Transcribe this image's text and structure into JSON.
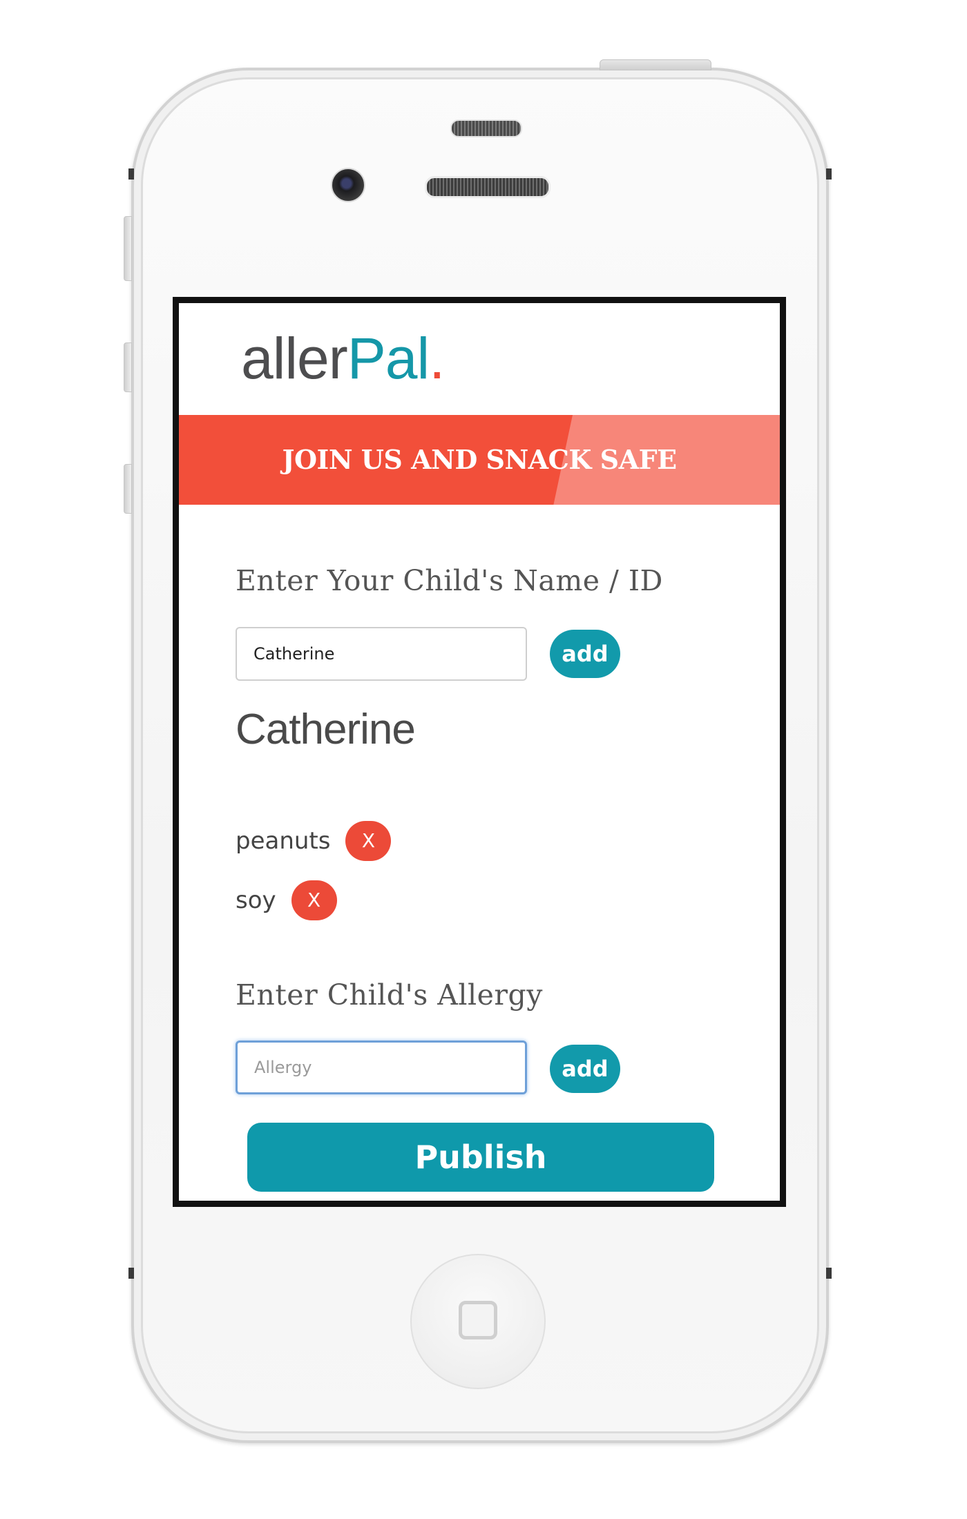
{
  "device": {
    "frame": "white smartphone",
    "icons": [
      "front-camera-icon",
      "speaker-icon",
      "home-button-icon"
    ]
  },
  "app": {
    "logo": {
      "part1": "aller",
      "part2": "Pal",
      "part3": "."
    },
    "banner": {
      "text": "JOIN US AND SNACK SAFE"
    }
  },
  "name_section": {
    "label": "Enter Your Child's Name / ID",
    "input_value": "Catherine",
    "add_label": "add"
  },
  "child": {
    "name": "Catherine",
    "allergies": [
      {
        "name": "peanuts",
        "remove_label": "X"
      },
      {
        "name": "soy",
        "remove_label": "X"
      }
    ]
  },
  "allergy_section": {
    "label": "Enter Child's Allergy",
    "placeholder": "Allergy",
    "add_label": "add"
  },
  "publish": {
    "label": "Publish"
  },
  "colors": {
    "brand_teal": "#129aab",
    "banner_red": "#f24f3a",
    "remove_red": "#ec4a38",
    "logo_gray": "#4d4d4f"
  }
}
